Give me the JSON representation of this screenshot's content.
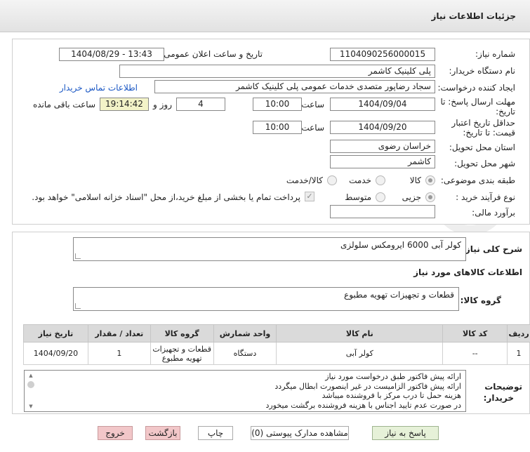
{
  "header": {
    "title": "جزئیات اطلاعات نیاز"
  },
  "form": {
    "need_number_label": "شماره نیاز:",
    "need_number": "1104090256000015",
    "announce_label": "تاریخ و ساعت اعلان عمومی:",
    "announce_value": "1404/08/29 - 13:43",
    "buyer_label": "نام دستگاه خریدار:",
    "buyer_value": "پلی کلینیک کاشمر",
    "creator_label": "ایجاد کننده درخواست:",
    "creator_value": "سجاد رضاپور متصدی خدمات عمومی پلی کلینیک کاشمر",
    "contact_link": "اطلاعات تماس خریدار",
    "deadline_label_1": "مهلت ارسال پاسخ: تا",
    "deadline_label_2": "تاریخ:",
    "deadline_date": "1404/09/04",
    "time_label": "ساعت",
    "deadline_time": "10:00",
    "days_value": "4",
    "days_label": "روز و",
    "remaining_time": "19:14:42",
    "remaining_label": "ساعت باقی مانده",
    "validity_label_1": "حداقل تاریخ اعتبار",
    "validity_label_2": "قیمت: تا تاریخ:",
    "validity_date": "1404/09/20",
    "validity_time": "10:00",
    "province_label": "استان محل تحویل:",
    "province_value": "خراسان رضوی",
    "city_label": "شهر محل تحویل:",
    "city_value": "کاشمر",
    "category_label": "طبقه بندی موضوعی:",
    "category_options": [
      "کالا",
      "خدمت",
      "کالا/خدمت"
    ],
    "purchase_label": "نوع فرآیند خرید :",
    "purchase_options": [
      "جزیی",
      "متوسط"
    ],
    "payment_note": "پرداخت تمام یا بخشی از مبلغ خرید،از محل \"اسناد خزانه اسلامی\" خواهد بود.",
    "budget_label": "برآورد مالی:",
    "budget_value": ""
  },
  "section2": {
    "description_label": "شرح کلی نیاز:",
    "description_value": "کولر آبی 6000 ایرومکس سلولزی",
    "goods_info_title": "اطلاعات کالاهای مورد نیاز",
    "goods_group_label": "گروه کالا:",
    "goods_group_value": "قطعات و تجهیزات تهویه مطبوع",
    "table": {
      "headers": [
        "ردیف",
        "کد کالا",
        "نام کالا",
        "واحد شمارش",
        "گروه کالا",
        "تعداد / مقدار",
        "تاریخ نیاز"
      ],
      "rows": [
        [
          "1",
          "--",
          "کولر آبی",
          "دستگاه",
          "قطعات و تجهیزات تهویه مطبوع",
          "1",
          "1404/09/20"
        ]
      ]
    },
    "buyer_notes_label_1": "توضیحات",
    "buyer_notes_label_2": "خریدار:",
    "buyer_notes": [
      "ارائه پیش فاکتور طبق درخواست مورد نیاز",
      "ارائه پیش فاکتور الزامیست در غیر اینصورت ابطال میگردد",
      "هزینه حمل تا درب مرکز با فروشنده میباشد",
      "در صورت عدم تایید اجناس با هزینه فروشنده برگشت میخورد"
    ]
  },
  "buttons": {
    "reply": "پاسخ به نیاز",
    "documents": "مشاهده مدارک پیوستی (0)",
    "print": "چاپ",
    "back": "بازگشت",
    "exit": "خروج"
  },
  "colors": {
    "button_green": "#e6f1d8",
    "button_pink": "#f2c7c9",
    "link_blue": "#1a57c4",
    "remaining_bg": "#f3f3c8"
  }
}
